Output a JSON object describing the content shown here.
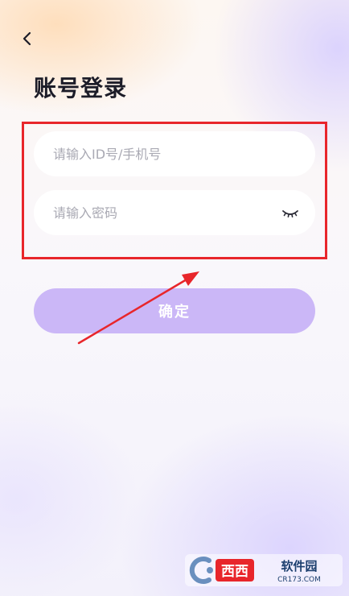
{
  "header": {
    "back_icon": "chevron-left-icon",
    "title": "账号登录"
  },
  "form": {
    "id_placeholder": "请输入ID号/手机号",
    "id_value": "",
    "password_placeholder": "请输入密码",
    "password_value": "",
    "password_toggle_icon": "eye-closed-icon"
  },
  "actions": {
    "confirm_label": "确定"
  },
  "annotation": {
    "box_color": "#e8262b",
    "arrow_color": "#e8262b"
  },
  "watermark": {
    "name": "西西软件园",
    "url": "CR173.COM"
  },
  "colors": {
    "button_bg": "#cbb7f7",
    "title_text": "#1c1c28",
    "placeholder": "#a9a9b3"
  }
}
